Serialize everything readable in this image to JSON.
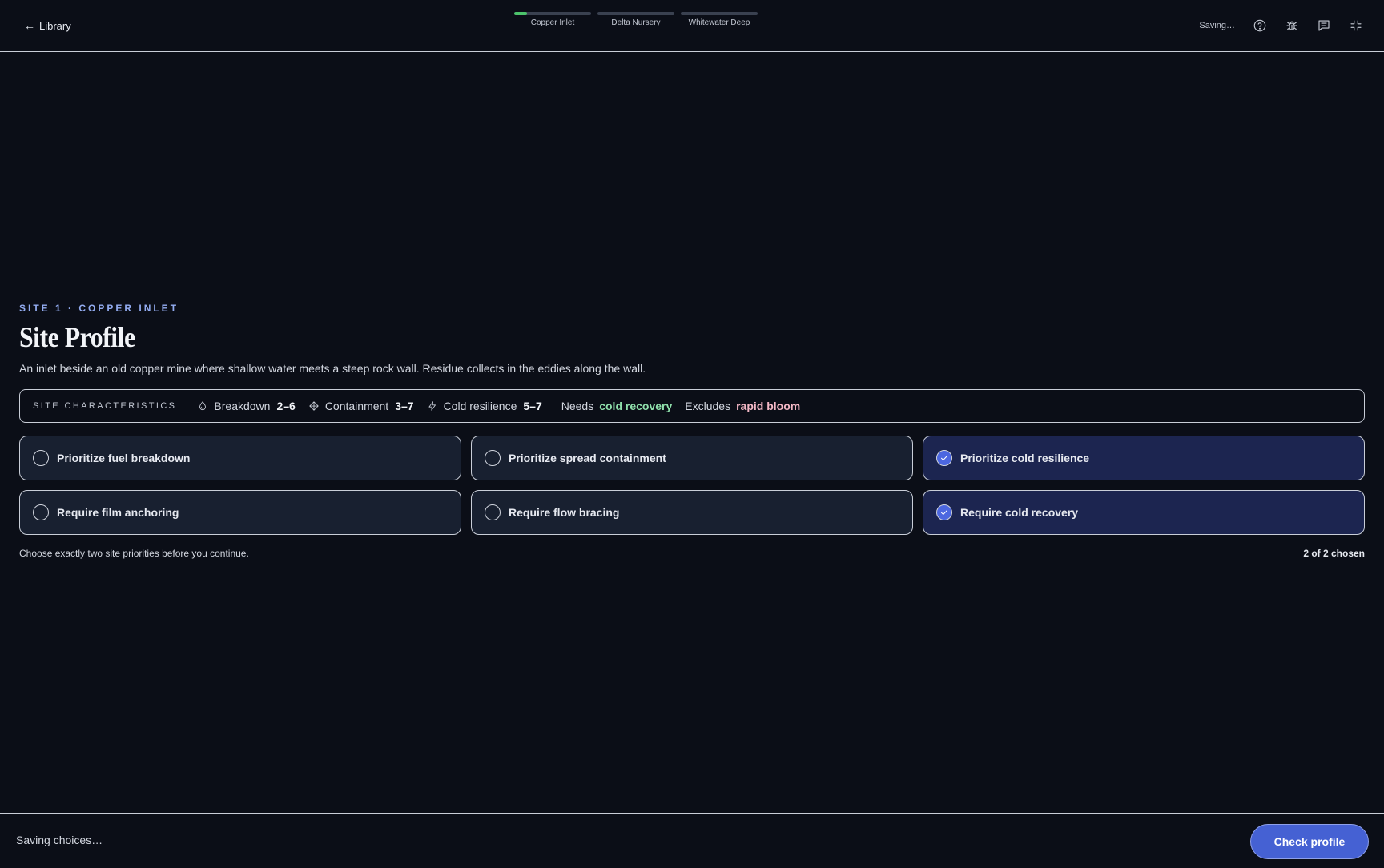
{
  "header": {
    "back_label": "Library",
    "saving_status": "Saving…",
    "steps": [
      {
        "label": "Copper Inlet",
        "progress": 0.17
      },
      {
        "label": "Delta Nursery",
        "progress": 0
      },
      {
        "label": "Whitewater Deep",
        "progress": 0
      }
    ],
    "icons": [
      "help-circle-icon",
      "bug-icon",
      "message-icon",
      "minimize-icon"
    ]
  },
  "site": {
    "eyebrow": "SITE 1 · COPPER INLET",
    "title": "Site Profile",
    "description": "An inlet beside an old copper mine where shallow water meets a steep rock wall. Residue collects in the eddies along the wall."
  },
  "characteristics": {
    "label": "SITE CHARACTERISTICS",
    "breakdown": {
      "name": "Breakdown",
      "value": "2–6"
    },
    "containment": {
      "name": "Containment",
      "value": "3–7"
    },
    "cold_resilience": {
      "name": "Cold resilience",
      "value": "5–7"
    },
    "needs": {
      "name": "Needs",
      "value": "cold recovery"
    },
    "excludes": {
      "name": "Excludes",
      "value": "rapid bloom"
    }
  },
  "options": [
    {
      "label": "Prioritize fuel breakdown",
      "selected": false
    },
    {
      "label": "Prioritize spread containment",
      "selected": false
    },
    {
      "label": "Prioritize cold resilience",
      "selected": true
    },
    {
      "label": "Require film anchoring",
      "selected": false
    },
    {
      "label": "Require flow bracing",
      "selected": false
    },
    {
      "label": "Require cold recovery",
      "selected": true
    }
  ],
  "hint": "Choose exactly two site priorities before you continue.",
  "count_text": "2 of 2 chosen",
  "footer": {
    "status": "Saving choices…",
    "check_label": "Check profile"
  },
  "colors": {
    "background": "#0b0e17",
    "accent": "#4561d3",
    "progress": "#4cc36b",
    "needs": "#8fe0ab",
    "excludes": "#f4b8c6",
    "eyebrow": "#93acf1"
  }
}
